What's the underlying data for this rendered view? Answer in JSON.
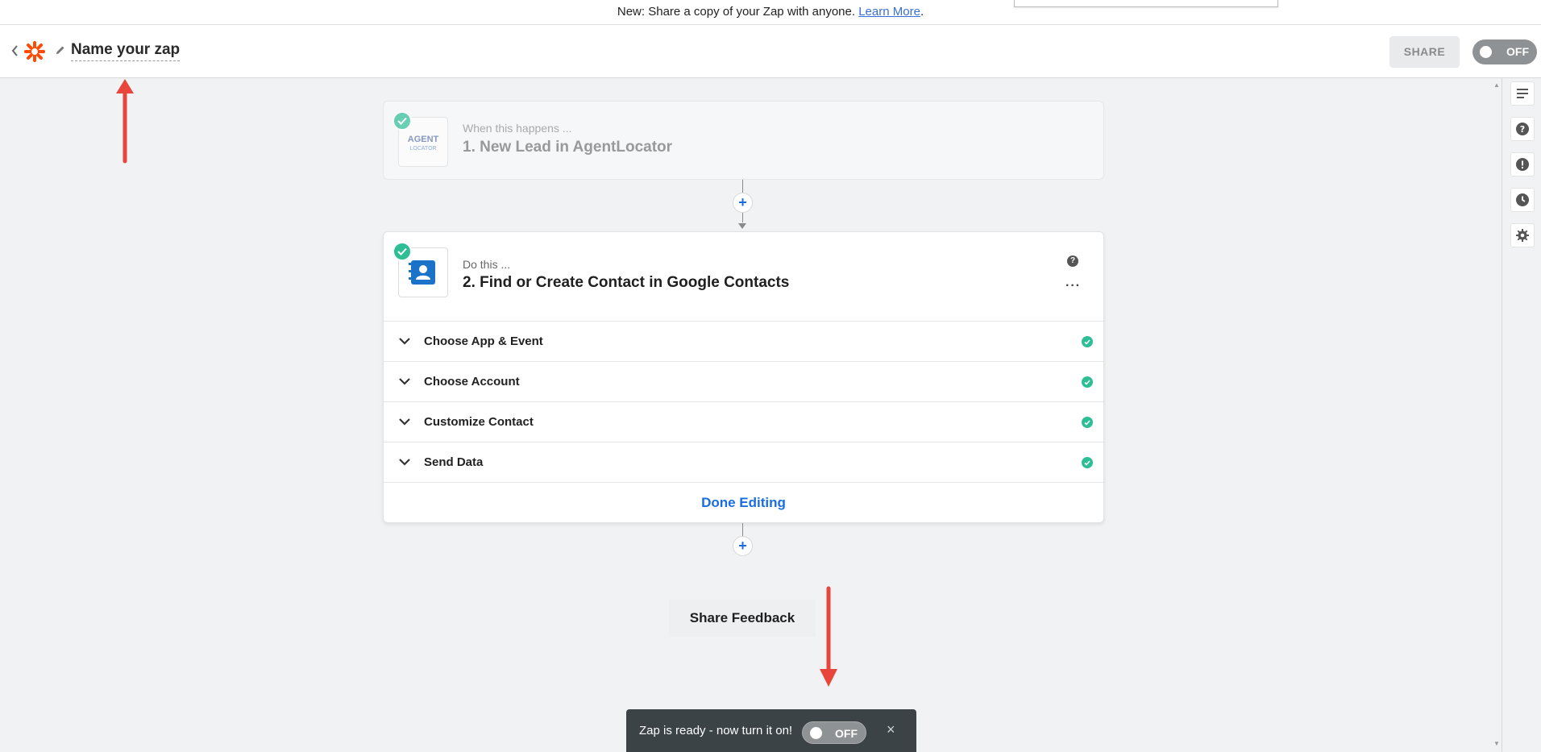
{
  "announcement": {
    "text": "New: Share a copy of your Zap with anyone.",
    "link": "Learn More",
    "trailing": "."
  },
  "header": {
    "zap_name": "Name your zap",
    "share_label": "SHARE",
    "toggle_label": "OFF"
  },
  "colors": {
    "brand": "#ff4a00",
    "accent": "#1a6de0",
    "success": "#2dbe96",
    "annotation": "#e8453c"
  },
  "steps": [
    {
      "subtitle": "When this happens ...",
      "title": "1. New Lead in AgentLocator",
      "app_logo_text_top": "AGENT",
      "app_logo_text_bottom": "LOCATOR",
      "icon": "agentlocator-logo"
    },
    {
      "subtitle": "Do this ...",
      "title": "2. Find or Create Contact in Google Contacts",
      "icon": "google-contacts-icon",
      "sections": [
        {
          "label": "Choose App & Event"
        },
        {
          "label": "Choose Account"
        },
        {
          "label": "Customize Contact"
        },
        {
          "label": "Send Data"
        }
      ],
      "done_label": "Done Editing"
    }
  ],
  "feedback_label": "Share Feedback",
  "toast": {
    "message": "Zap is ready - now turn it on!",
    "toggle_label": "OFF"
  },
  "right_rail": [
    "details-icon",
    "help-icon",
    "alert-icon",
    "history-icon",
    "settings-icon"
  ]
}
